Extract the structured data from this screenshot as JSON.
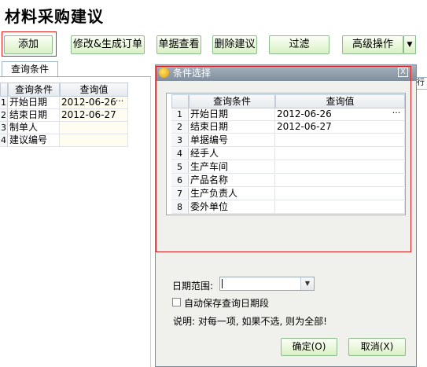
{
  "app": {
    "title": "材料采购建议"
  },
  "toolbar": {
    "add": "添加",
    "edit_generate": "修改&生成订单",
    "view_doc": "单据查看",
    "delete": "删除建议",
    "filter": "过滤",
    "advanced": "高级操作",
    "dropdown_icon": "chevron-down-icon"
  },
  "left_tab": {
    "label": "查询条件"
  },
  "left_grid": {
    "headers": [
      "查询条件",
      "查询值"
    ],
    "rows": [
      {
        "no": "1",
        "cond": "开始日期",
        "value": "2012-06-26"
      },
      {
        "no": "2",
        "cond": "结束日期",
        "value": "2012-06-27"
      },
      {
        "no": "3",
        "cond": "制单人",
        "value": ""
      },
      {
        "no": "4",
        "cond": "建议编号",
        "value": ""
      }
    ],
    "ellipsis": "···"
  },
  "background_fragment": "行",
  "dialog": {
    "title": "条件选择",
    "close": "X",
    "grid_headers": [
      "查询条件",
      "查询值"
    ],
    "rows": [
      {
        "no": "1",
        "cond": "开始日期",
        "value": "2012-06-26"
      },
      {
        "no": "2",
        "cond": "结束日期",
        "value": "2012-06-27"
      },
      {
        "no": "3",
        "cond": "单据编号",
        "value": ""
      },
      {
        "no": "4",
        "cond": "经手人",
        "value": ""
      },
      {
        "no": "5",
        "cond": "生产车间",
        "value": ""
      },
      {
        "no": "6",
        "cond": "产品名称",
        "value": ""
      },
      {
        "no": "7",
        "cond": "生产负责人",
        "value": ""
      },
      {
        "no": "8",
        "cond": "委外单位",
        "value": ""
      }
    ],
    "ellipsis": "···",
    "date_range_label": "日期范围:",
    "date_range_value": "",
    "autosave_label": "自动保存查询日期段",
    "note": "说明: 对每一项, 如果不选, 则为全部!",
    "ok": "确定(O)",
    "cancel": "取消(X)"
  },
  "colors": {
    "button_border": "#8fbc8f",
    "highlight_red": "#e02020",
    "title_bar": "#8e9cab"
  }
}
